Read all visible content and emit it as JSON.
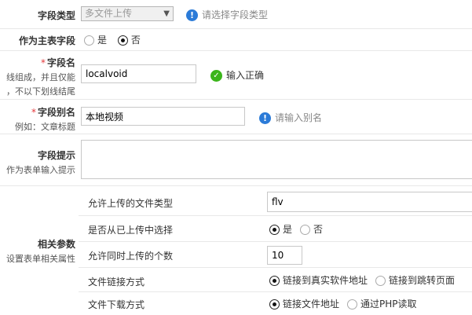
{
  "field_type": {
    "label": "字段类型",
    "select_value": "多文件上传",
    "hint": "请选择字段类型"
  },
  "main_table_field": {
    "label": "作为主表字段",
    "options": [
      "是",
      "否"
    ],
    "selected": "否"
  },
  "field_name": {
    "required_mark": "*",
    "label": "字段名",
    "desc_line1": "线组成，并且仅能",
    "desc_line2": "，不以下划线结尾",
    "value": "localvoid",
    "hint": "输入正确"
  },
  "field_alias": {
    "required_mark": "*",
    "label": "字段别名",
    "desc": "例如：文章标题",
    "value": "本地视频",
    "hint": "请输入别名"
  },
  "field_tip": {
    "label": "字段提示",
    "desc": "作为表单输入提示",
    "value": ""
  },
  "related_params": {
    "label": "相关参数",
    "desc": "设置表单相关属性",
    "rows": [
      {
        "key": "允许上传的文件类型",
        "input_value": "flv"
      },
      {
        "key": "是否从已上传中选择",
        "options": [
          "是",
          "否"
        ],
        "selected": "是"
      },
      {
        "key": "允许同时上传的个数",
        "input_value": "10"
      },
      {
        "key": "文件链接方式",
        "options": [
          "链接到真实软件地址",
          "链接到跳转页面"
        ],
        "selected": "链接到真实软件地址"
      },
      {
        "key": "文件下载方式",
        "options": [
          "链接文件地址",
          "通过PHP读取"
        ],
        "selected": "链接文件地址"
      }
    ]
  },
  "colors": {
    "info_icon": "#2b7bd8",
    "ok_icon": "#3bb51b",
    "required": "#e4393c",
    "divider": "#e8e8e8"
  }
}
